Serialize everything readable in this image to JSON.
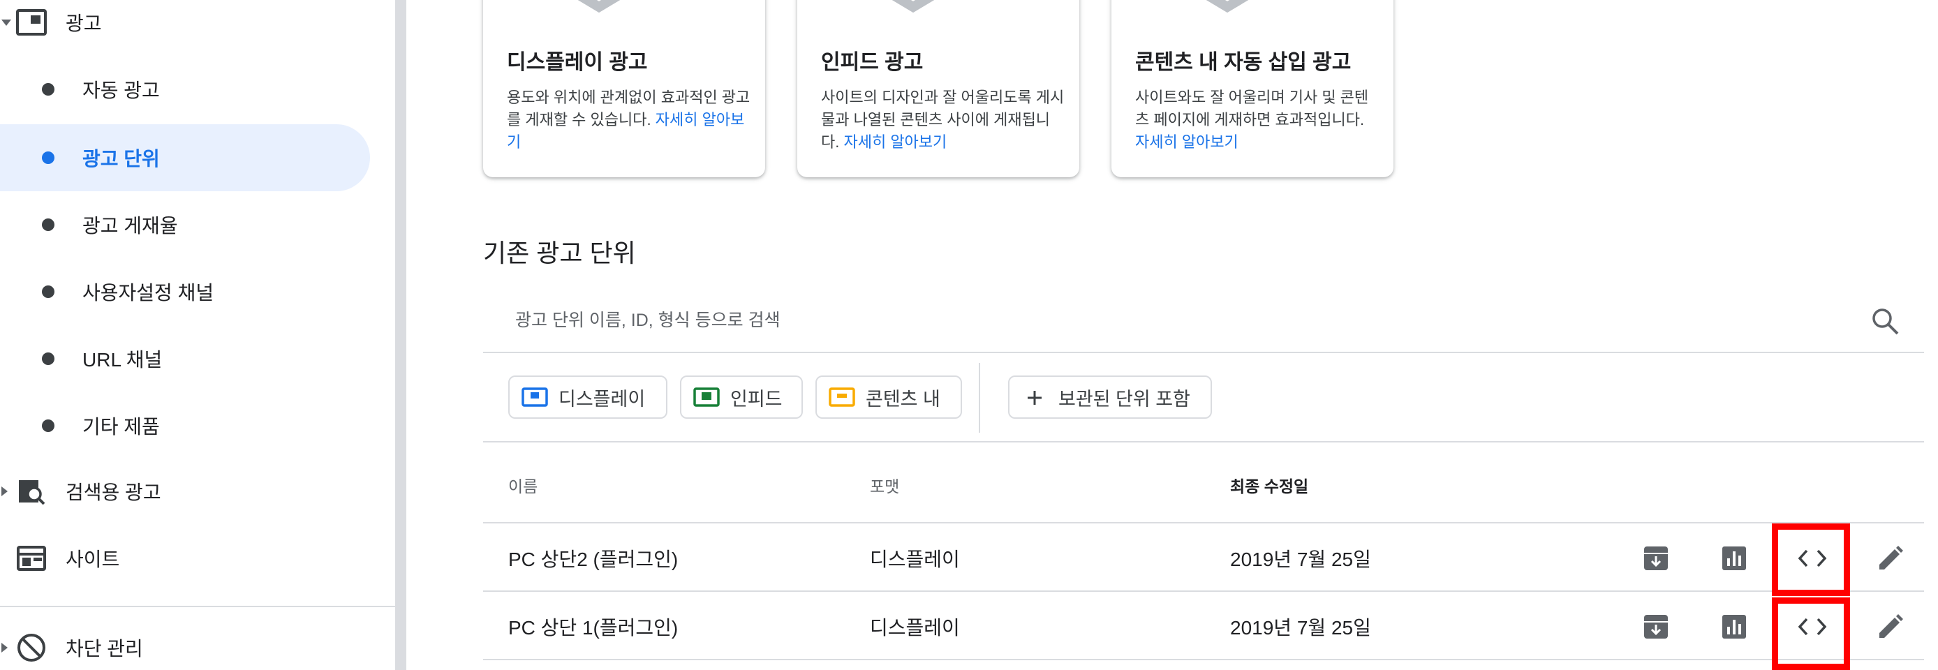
{
  "sidebar": {
    "ads_label": "광고",
    "sub_items": [
      {
        "label": "자동 광고"
      },
      {
        "label": "광고 단위"
      },
      {
        "label": "광고 게재율"
      },
      {
        "label": "사용자설정 채널"
      },
      {
        "label": "URL 채널"
      },
      {
        "label": "기타 제품"
      }
    ],
    "search_ads_label": "검색용 광고",
    "sites_label": "사이트",
    "blocking_label": "차단 관리"
  },
  "cards": [
    {
      "title": "디스플레이 광고",
      "desc": "용도와 위치에 관계없이 효과적인 광고를 게재할 수 있습니다.",
      "link": "자세히 알아보기"
    },
    {
      "title": "인피드 광고",
      "desc": "사이트의 디자인과 잘 어울리도록 게시물과 나열된 콘텐츠 사이에 게재됩니다.",
      "link": "자세히 알아보기"
    },
    {
      "title": "콘텐츠 내 자동 삽입 광고",
      "desc": "사이트와도 잘 어울리며 기사 및 콘텐츠 페이지에 게재하면 효과적입니다.",
      "link": "자세히 알아보기"
    }
  ],
  "section": {
    "title": "기존 광고 단위",
    "search_placeholder": "광고 단위 이름, ID, 형식 등으로 검색"
  },
  "filters": {
    "display": "디스플레이",
    "infeed": "인피드",
    "in_article": "콘텐츠 내",
    "include_archived": "보관된 단위 포함"
  },
  "table": {
    "headers": {
      "name": "이름",
      "format": "포맷",
      "modified": "최종 수정일"
    },
    "rows": [
      {
        "name": "PC 상단2 (플러그인)",
        "format": "디스플레이",
        "modified": "2019년 7월 25일"
      },
      {
        "name": "PC 상단 1(플러그인)",
        "format": "디스플레이",
        "modified": "2019년 7월 25일"
      }
    ]
  },
  "colors": {
    "accent": "#1a73e8",
    "active_bg": "#e8f0fe",
    "highlight": "#ff0000",
    "display_chip": "#1a73e8",
    "infeed_chip": "#188038",
    "in_article_chip": "#f9ab00"
  },
  "icons": {
    "archive": "archive-icon",
    "report": "bar-chart-icon",
    "code": "code-icon",
    "edit": "edit-icon",
    "search": "search-icon"
  }
}
